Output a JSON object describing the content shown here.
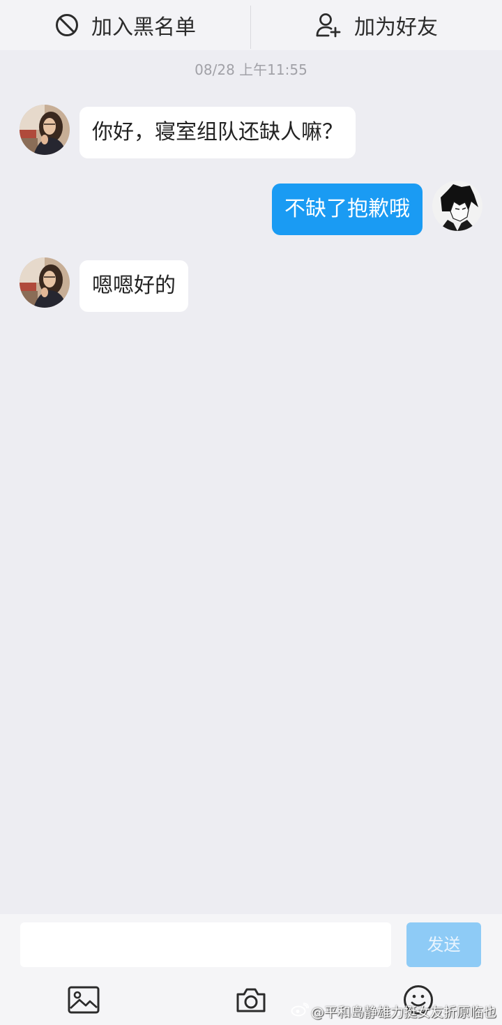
{
  "header": {
    "block_label": "加入黑名单",
    "block_icon": "ban-icon",
    "add_friend_label": "加为好友",
    "add_friend_icon": "add-user-icon"
  },
  "timestamp": "08/28 上午11:55",
  "messages": [
    {
      "sender": "other",
      "text": "你好，寝室组队还缺人嘛？"
    },
    {
      "sender": "me",
      "text": "不缺了抱歉哦"
    },
    {
      "sender": "other",
      "text": "嗯嗯好的"
    }
  ],
  "composer": {
    "input_value": "",
    "send_label": "发送"
  },
  "toolbar": {
    "icons": [
      "image-icon",
      "camera-icon",
      "emoji-icon"
    ]
  },
  "watermark": {
    "text": "@平和岛静雄力挺女友折原临也",
    "icon": "weibo-logo-icon"
  },
  "colors": {
    "background": "#ededf2",
    "accent": "#1a9bf3",
    "send_button": "#8ecbf6",
    "incoming_bubble": "#ffffff"
  }
}
